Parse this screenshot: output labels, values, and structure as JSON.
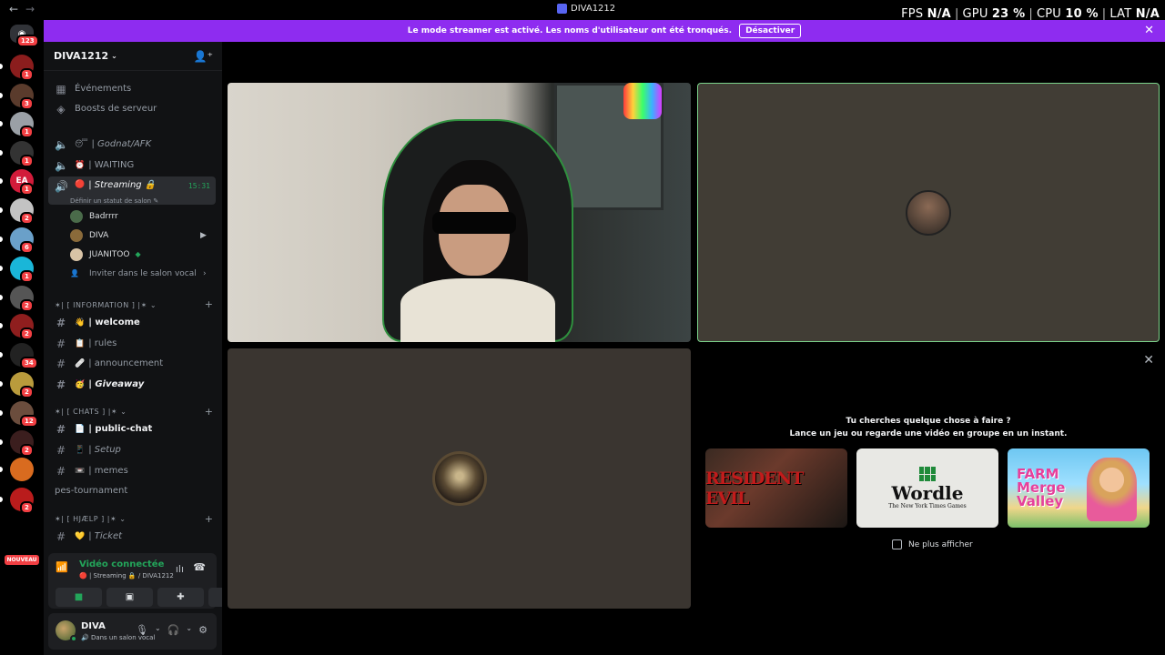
{
  "window": {
    "title": "DIVA1212"
  },
  "perf": {
    "fps_label": "FPS",
    "fps_value": "N/A",
    "gpu_label": "GPU",
    "gpu_value": "23 %",
    "cpu_label": "CPU",
    "cpu_value": "10 %",
    "lat_label": "LAT",
    "lat_value": "N/A"
  },
  "banner": {
    "text": "Le mode streamer est activé. Les noms d'utilisateur ont été tronqués.",
    "button": "Désactiver"
  },
  "rail": {
    "home_badge": "123",
    "servers": [
      {
        "badge": "1",
        "color": "#8b1d1d"
      },
      {
        "badge": "3",
        "color": "#5a3b2c"
      },
      {
        "badge": "1",
        "color": "#9aa0a6"
      },
      {
        "badge": "1",
        "color": "#333333"
      },
      {
        "badge": "1",
        "color": "#d21b3a",
        "text": "EA"
      },
      {
        "badge": "2",
        "color": "#c3c3c3"
      },
      {
        "badge": "6",
        "color": "#6aa0c9"
      },
      {
        "badge": "1",
        "color": "#1ab6d8"
      },
      {
        "badge": "2",
        "color": "#555555"
      },
      {
        "badge": "2",
        "color": "#8f1e1e"
      },
      {
        "badge": "34",
        "color": "#222222"
      },
      {
        "badge": "2",
        "color": "#b99b3c"
      },
      {
        "badge": "12",
        "color": "#6b4d3d"
      },
      {
        "badge": "2",
        "color": "#3b1e1e"
      },
      {
        "badge": "",
        "color": "#d96b1f"
      },
      {
        "badge": "2",
        "color": "#b91c1c"
      }
    ],
    "nouveau": "NOUVEAU"
  },
  "sidebar": {
    "server_name": "DIVA1212",
    "events": "Événements",
    "boosts": "Boosts de serveur",
    "voice_channels": [
      {
        "emoji": "😴",
        "name": "Godnat/AFK"
      },
      {
        "emoji": "⏰",
        "name": "WAITING"
      },
      {
        "emoji": "🔴",
        "name": "Streaming 🔒",
        "timer": "15:31",
        "status": "Définir un statut de salon ✎"
      }
    ],
    "members": [
      {
        "name": "Badrrrr"
      },
      {
        "name": "DIVA"
      },
      {
        "name": "JUANITOO"
      }
    ],
    "invite_voice": "Inviter dans le salon vocal",
    "categories": {
      "information": "✶| [ INFORMATION ] |✶",
      "chats": "✶| [ CHATS ] |✶",
      "help": "✶| [ HJÆLP ] |✶"
    },
    "text_channels": {
      "welcome": {
        "emoji": "👋",
        "name": "welcome"
      },
      "rules": {
        "emoji": "📋",
        "name": "rules"
      },
      "announcement": {
        "emoji": "🩹",
        "name": "announcement"
      },
      "giveaway": {
        "emoji": "🥳",
        "name": "Giveaway"
      },
      "public_chat": {
        "emoji": "📄",
        "name": "public-chat"
      },
      "setup": {
        "emoji": "📱",
        "name": "Setup"
      },
      "memes": {
        "emoji": "📼",
        "name": "memes"
      },
      "pes": {
        "name": "pes-tournament"
      },
      "ticket": {
        "emoji": "💛",
        "name": "Ticket"
      }
    }
  },
  "voice_panel": {
    "title": "Vidéo connectée",
    "sub": "🔴 | Streaming 🔒 / DIVA1212"
  },
  "user_panel": {
    "name": "DIVA",
    "status": "🔊 Dans un salon vocal"
  },
  "activity": {
    "line1": "Tu cherches quelque chose à faire ?",
    "line2": "Lance un jeu ou regarde une vidéo en groupe en un instant.",
    "cards": [
      {
        "title": "RESIDENT EVIL"
      },
      {
        "title": "Wordle",
        "subtitle": "The New York Times Games"
      },
      {
        "title": "FARM Merge Valley"
      }
    ],
    "dont_show": "Ne plus afficher"
  }
}
